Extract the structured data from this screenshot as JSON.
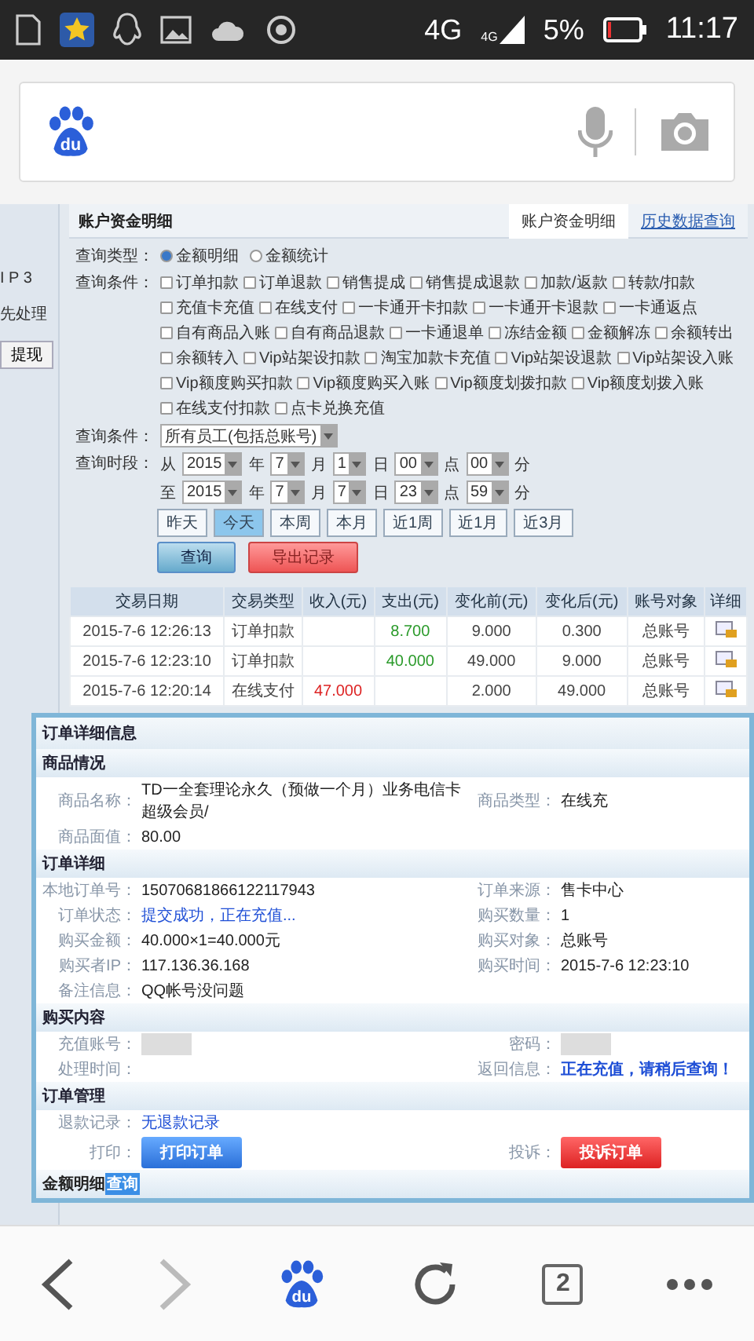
{
  "status_bar": {
    "network": "4G",
    "signal_label": "4G",
    "battery": "5%",
    "time": "11:17"
  },
  "browser": {
    "logo_text": "du"
  },
  "sidebar": {
    "items": [
      {
        "label": "I P 3"
      },
      {
        "label": "先处理"
      }
    ],
    "button": "提现"
  },
  "panel": {
    "title": "账户资金明细",
    "tabs": [
      {
        "label": "账户资金明细",
        "selected": true
      },
      {
        "label": "历史数据查询",
        "selected": false
      }
    ]
  },
  "query": {
    "type_label": "查询类型：",
    "types": [
      {
        "label": "金额明细",
        "selected": true
      },
      {
        "label": "金额统计",
        "selected": false
      }
    ],
    "conditions_label": "查询条件：",
    "conditions": [
      {
        "label": "订单扣款",
        "checked": false
      },
      {
        "label": "订单退款",
        "checked": false
      },
      {
        "label": "销售提成",
        "checked": false
      },
      {
        "label": "销售提成退款",
        "checked": false
      },
      {
        "label": "加款/返款",
        "checked": false
      },
      {
        "label": "转款/扣款",
        "checked": false
      },
      {
        "label": "充值卡充值",
        "checked": false
      },
      {
        "label": "在线支付",
        "checked": false
      },
      {
        "label": "一卡通开卡扣款",
        "checked": false
      },
      {
        "label": "一卡通开卡退款",
        "checked": false
      },
      {
        "label": "一卡通返点",
        "checked": false
      },
      {
        "label": "自有商品入账",
        "checked": false
      },
      {
        "label": "自有商品退款",
        "checked": false
      },
      {
        "label": "一卡通退单",
        "checked": false
      },
      {
        "label": "冻结金额",
        "checked": false
      },
      {
        "label": "金额解冻",
        "checked": false
      },
      {
        "label": "余额转出",
        "checked": false
      },
      {
        "label": "余额转入",
        "checked": false
      },
      {
        "label": "Vip站架设扣款",
        "checked": false
      },
      {
        "label": "淘宝加款卡充值",
        "checked": false
      },
      {
        "label": "Vip站架设退款",
        "checked": false
      },
      {
        "label": "Vip站架设入账",
        "checked": false
      },
      {
        "label": "Vip额度购买扣款",
        "checked": false
      },
      {
        "label": "Vip额度购买入账",
        "checked": false
      },
      {
        "label": "Vip额度划拨扣款",
        "checked": false
      },
      {
        "label": "Vip额度划拨入账",
        "checked": false
      },
      {
        "label": "在线支付扣款",
        "checked": false
      },
      {
        "label": "点卡兑换充值",
        "checked": false
      }
    ],
    "staff_label": "查询条件：",
    "staff_value": "所有员工(包括总账号)",
    "time_label": "查询时段：",
    "time_rows": [
      {
        "prefix": "从",
        "fields": [
          {
            "value": "2015",
            "unit": "年"
          },
          {
            "value": "7",
            "unit": "月"
          },
          {
            "value": "1",
            "unit": "日"
          },
          {
            "value": "00",
            "unit": "点"
          },
          {
            "value": "00",
            "unit": "分"
          }
        ]
      },
      {
        "prefix": "至",
        "fields": [
          {
            "value": "2015",
            "unit": "年"
          },
          {
            "value": "7",
            "unit": "月"
          },
          {
            "value": "7",
            "unit": "日"
          },
          {
            "value": "23",
            "unit": "点"
          },
          {
            "value": "59",
            "unit": "分"
          }
        ]
      }
    ],
    "ranges": [
      {
        "label": "昨天",
        "selected": false
      },
      {
        "label": "今天",
        "selected": true
      },
      {
        "label": "本周",
        "selected": false
      },
      {
        "label": "本月",
        "selected": false
      },
      {
        "label": "近1周",
        "selected": false
      },
      {
        "label": "近1月",
        "selected": false
      },
      {
        "label": "近3月",
        "selected": false
      }
    ],
    "search_button": "查询",
    "export_button": "导出记录"
  },
  "table": {
    "columns": [
      "交易日期",
      "交易类型",
      "收入(元)",
      "支出(元)",
      "变化前(元)",
      "变化后(元)",
      "账号对象",
      "详细"
    ],
    "rows": [
      {
        "date": "2015-7-6 12:26:13",
        "type": "订单扣款",
        "expense": "8.700",
        "before": "9.000",
        "after": "0.300",
        "account": "总账号"
      },
      {
        "date": "2015-7-6 12:23:10",
        "type": "订单扣款",
        "expense": "40.000",
        "before": "49.000",
        "after": "9.000",
        "account": "总账号"
      },
      {
        "date": "2015-7-6 12:20:14",
        "type": "在线支付",
        "income": "47.000",
        "before": "2.000",
        "after": "49.000",
        "account": "总账号"
      }
    ]
  },
  "dialog": {
    "title": "订单详细信息",
    "sections": [
      {
        "title": "商品情况",
        "rows": [
          [
            {
              "label": "商品名称：",
              "value": "TD一全套理论永久（预做一个月）业务电信卡超级会员/",
              "kind": "text"
            },
            {
              "label": "商品类型：",
              "value": "在线充",
              "kind": "text"
            }
          ],
          [
            {
              "label": "商品面值：",
              "value": "80.00",
              "kind": "text"
            }
          ]
        ]
      },
      {
        "title": "订单详细",
        "rows": [
          [
            {
              "label": "本地订单号：",
              "value": "15070681866122117943",
              "kind": "text"
            },
            {
              "label": "订单来源：",
              "value": "售卡中心",
              "kind": "text"
            }
          ],
          [
            {
              "label": "订单状态：",
              "value": "提交成功，正在充值...",
              "kind": "link"
            },
            {
              "label": "购买数量：",
              "value": "1",
              "kind": "text"
            }
          ],
          [
            {
              "label": "购买金额：",
              "value": "40.000×1=40.000元",
              "kind": "text"
            },
            {
              "label": "购买对象：",
              "value": "总账号",
              "kind": "text"
            }
          ],
          [
            {
              "label": "购买者IP：",
              "value": "117.136.36.168",
              "kind": "text"
            },
            {
              "label": "购买时间：",
              "value": "2015-7-6 12:23:10",
              "kind": "text"
            }
          ],
          [
            {
              "label": "备注信息：",
              "value": "QQ帐号没问题",
              "kind": "text"
            }
          ]
        ]
      },
      {
        "title": "购买内容",
        "rows": [
          [
            {
              "label": "充值账号：",
              "kind": "redacted"
            },
            {
              "label": "密码：",
              "kind": "redacted"
            }
          ],
          [
            {
              "label": "处理时间：",
              "kind": "text"
            },
            {
              "label": "返回信息：",
              "value": "正在充值，请稍后查询！",
              "kind": "notice"
            }
          ]
        ]
      },
      {
        "title": "订单管理",
        "rows": [
          [
            {
              "label": "退款记录：",
              "value": "无退款记录",
              "kind": "link"
            }
          ],
          [
            {
              "label": "打印：",
              "value": "打印订单",
              "kind": "blue-button"
            },
            {
              "label": "投诉：",
              "value": "投诉订单",
              "kind": "red-button"
            }
          ]
        ]
      }
    ],
    "footer_title": "金额明细",
    "footer_link": "查询"
  },
  "bottom_bar": {
    "back_disabled": false,
    "forward_disabled": true,
    "logo_text": "du",
    "tab_count": "2"
  }
}
